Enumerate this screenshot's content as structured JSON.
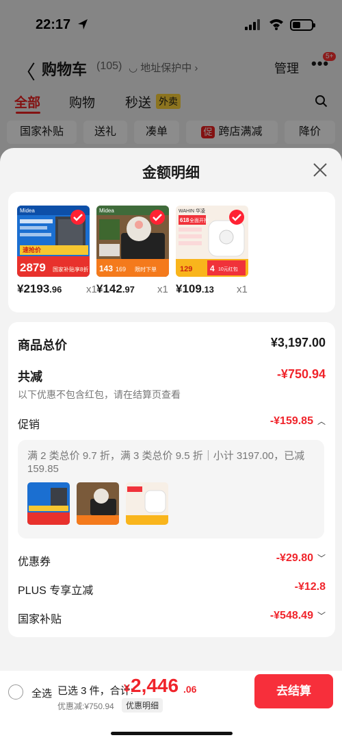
{
  "status": {
    "time": "22:17"
  },
  "nav": {
    "back": "〈",
    "title": "购物车",
    "count": "(105)",
    "address": "◡ 地址保护中 ›",
    "manage": "管理",
    "more": "•••",
    "badge": "5+"
  },
  "tabs": [
    {
      "label": "全部"
    },
    {
      "label": "购物"
    },
    {
      "label": "秒送"
    }
  ],
  "tab_badge": "外卖",
  "chips": [
    {
      "label": "国家补贴"
    },
    {
      "label": "送礼"
    },
    {
      "label": "凑单"
    },
    {
      "label": "跨店满减",
      "tag": "促"
    },
    {
      "label": "降价"
    }
  ],
  "sheet": {
    "title": "金额明细"
  },
  "products": [
    {
      "price_main": "¥2193",
      "price_dec": ".96",
      "qty": "x1"
    },
    {
      "price_main": "¥142",
      "price_dec": ".97",
      "qty": "x1"
    },
    {
      "price_main": "¥109",
      "price_dec": ".13",
      "qty": "x1"
    }
  ],
  "thumb_text": {
    "p1": {
      "brand": "Midea",
      "big": "2879",
      "strip": "速抢价",
      "foot": "国家补贴享8折"
    },
    "p2": {
      "brand": "Midea",
      "big": "143",
      "tag": "169",
      "foot": "限时下单"
    },
    "p3": {
      "brand": "WAHIN 华凌",
      "title": "618",
      "sub": "全面开抢",
      "big": "129",
      "foot": "4",
      "foot2": "10元红包"
    }
  },
  "summary": {
    "total_label": "商品总价",
    "total_value": "¥3,197.00",
    "reduce_label": "共减",
    "reduce_value": "-¥750.94",
    "note": "以下优惠不包含红包，请在结算页查看",
    "promo_label": "促销",
    "promo_value": "-¥159.85",
    "promo_text": "满 2 类总价 9.7 折，满 3 类总价 9.5 折｜小计 3197.00，已减 159.85",
    "coupon_label": "优惠券",
    "coupon_value": "-¥29.80",
    "plus_label": "PLUS 专享立减",
    "plus_value": "-¥12.8",
    "subsidy_label": "国家补贴",
    "subsidy_value": "-¥548.49"
  },
  "bottom": {
    "select_all": "全选",
    "selected": "已选 3 件，合计:",
    "currency": "¥",
    "total_int": "2,446",
    "total_dec": ".06",
    "discount": "优惠减:¥750.94",
    "detail": "优惠明细",
    "checkout": "去结算"
  },
  "colors": {
    "accent": "#f0242b",
    "checkout": "#f72f3b"
  }
}
